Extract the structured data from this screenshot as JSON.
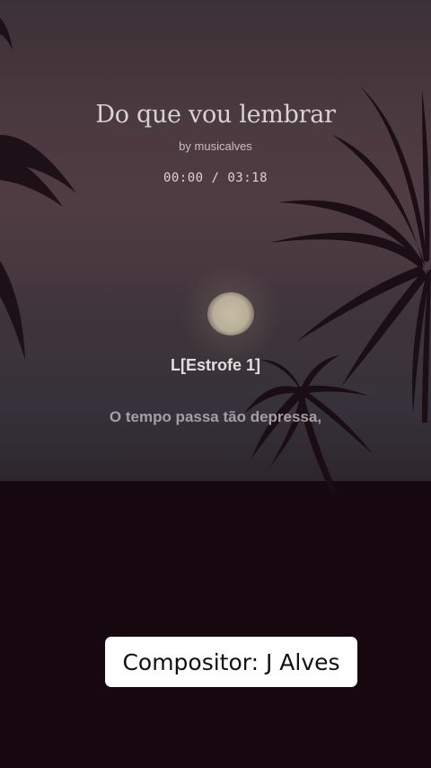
{
  "song": {
    "title": "Do que vou lembrar",
    "artist": "by musicalves",
    "time": "00:00 / 03:18"
  },
  "lyrics": {
    "section": "L[Estrofe 1]",
    "current_line": "O tempo passa tão depressa,"
  },
  "caption": {
    "text": "Compositor: J Alves"
  },
  "background": {
    "scene": "sunset-beach-palms",
    "colors": {
      "sky": "#4f3c42",
      "ground": "#17080f",
      "sun": "#c7bda6"
    }
  }
}
